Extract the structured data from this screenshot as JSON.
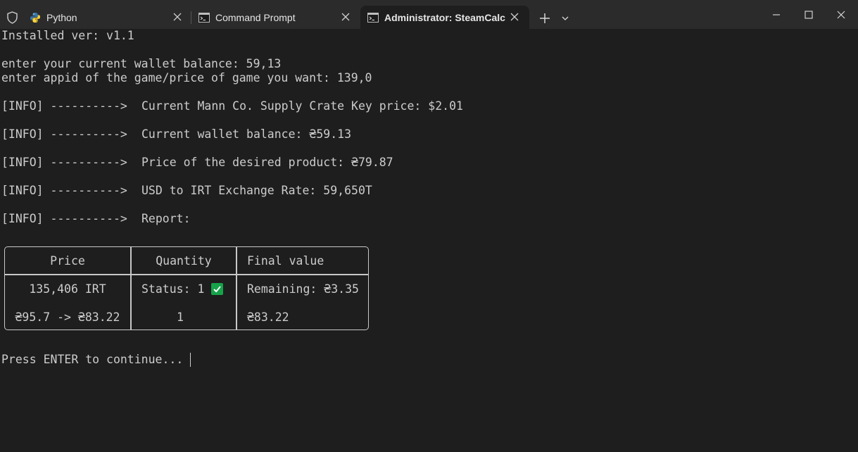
{
  "tabs": [
    {
      "label": "Python",
      "icon": "python-icon",
      "active": false
    },
    {
      "label": "Command Prompt",
      "icon": "cmd-icon",
      "active": false
    },
    {
      "label": "Administrator: SteamCalc",
      "icon": "cmd-icon",
      "active": true
    }
  ],
  "terminal": {
    "installed": "Installed ver: v1.1",
    "prompt_balance": "enter your current wallet balance: 59,13",
    "prompt_appid": "enter appid of the game/price of game you want: 139,0",
    "info_prefix": "[INFO] ---------->",
    "info_lines": [
      "Current Mann Co. Supply Crate Key price: $2.01",
      "Current wallet balance: ₴59.13",
      "Price of the desired product: ₴79.87",
      "USD to IRT Exchange Rate: 59,650T",
      "Report:"
    ],
    "table": {
      "headers": [
        "Price",
        "Quantity",
        "Final value"
      ],
      "row1": [
        "135,406 IRT",
        "Status: 1",
        "Remaining: ₴3.35"
      ],
      "row2": [
        "₴95.7 -> ₴83.22",
        "1",
        "₴83.22"
      ]
    },
    "continue_prompt": "Press ENTER to continue..."
  },
  "colors": {
    "background": "#1e1e1e",
    "titlebar": "#2b2b2b",
    "text": "#cccccc",
    "check_green": "#16a34a"
  }
}
